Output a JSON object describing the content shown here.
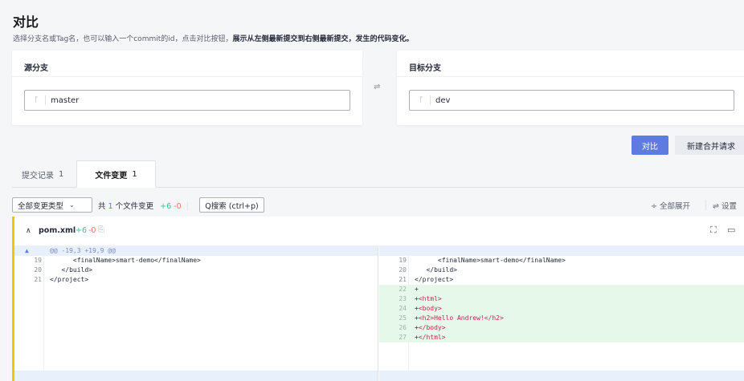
{
  "header": {
    "title": "对比",
    "description_prefix": "选择分支名或Tag名，也可以输入一个commit的id，点击对比按钮，",
    "description_bold": "展示从左侧最新提交到右侧最新提交，发生的代码变化。"
  },
  "source": {
    "label": "源分支",
    "branch": "master",
    "branch_icon": "branch-icon"
  },
  "swap_icon": "⇌",
  "target": {
    "label": "目标分支",
    "branch": "dev",
    "branch_icon": "branch-icon"
  },
  "actions": {
    "compare": "对比",
    "new_merge_request": "新建合并请求"
  },
  "tabs": [
    {
      "label": "提交记录",
      "count": "1"
    },
    {
      "label": "文件变更",
      "count": "1"
    }
  ],
  "toolbar": {
    "filter": "全部变更类型",
    "summary_prefix": "共",
    "summary_count": "1",
    "summary_suffix": "个文件变更",
    "additions": "+6",
    "deletions": "-0",
    "search": "Q搜索 (ctrl+p)",
    "expand_all": "全部展开",
    "settings": "设置"
  },
  "file": {
    "name": "pom.xml",
    "additions": "+6",
    "deletions": "-0"
  },
  "diff": {
    "hunk_header": "@@ -19,3 +19,9 @@",
    "left": [
      {
        "ln": "19",
        "code": "      <finalName>smart-demo</finalName>"
      },
      {
        "ln": "20",
        "code": "   </build>"
      },
      {
        "ln": "21",
        "code": "</project>"
      }
    ],
    "right": [
      {
        "ln": "19",
        "code": "      <finalName>smart-demo</finalName>"
      },
      {
        "ln": "20",
        "code": "   </build>"
      },
      {
        "ln": "21",
        "code": "</project>"
      }
    ],
    "added": [
      {
        "ln": "22",
        "prefix": "+",
        "code": ""
      },
      {
        "ln": "23",
        "prefix": "+",
        "code": "<html>"
      },
      {
        "ln": "24",
        "prefix": "+",
        "code": "<body>"
      },
      {
        "ln": "25",
        "prefix": "+",
        "code": "<h2>Hello Andrew!</h2>"
      },
      {
        "ln": "26",
        "prefix": "+",
        "code": "</body>"
      },
      {
        "ln": "27",
        "prefix": "+",
        "code": "</html>"
      }
    ]
  },
  "colors": {
    "accent": "#5e7ce0",
    "added_bg": "#e6f8e9",
    "hunk_bg": "#e8f0fc",
    "file_marker": "#fac20a"
  }
}
